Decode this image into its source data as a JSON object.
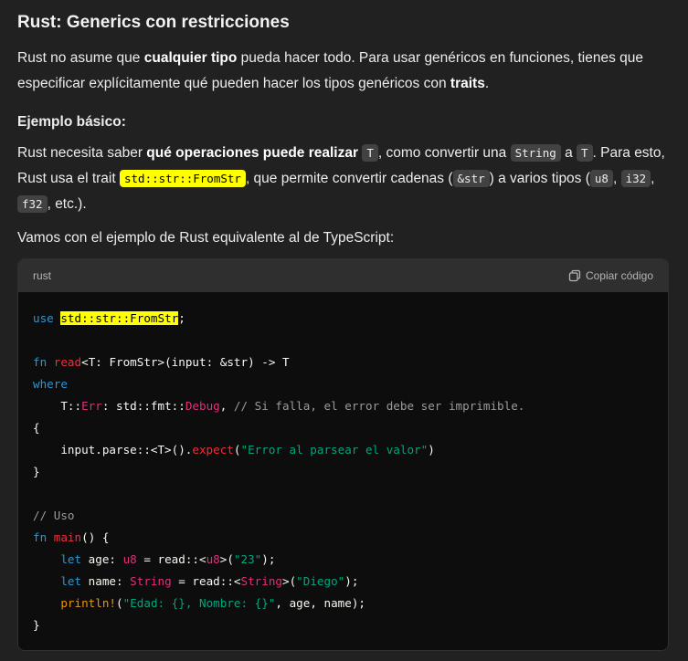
{
  "title": "Rust: Generics con restricciones",
  "intro": {
    "t1": "Rust no asume que ",
    "b1": "cualquier tipo",
    "t2": " pueda hacer todo. Para usar genéricos en funciones, tienes que especificar explícitamente qué pueden hacer los tipos genéricos con ",
    "b2": "traits",
    "t3": "."
  },
  "section_heading": "Ejemplo básico:",
  "para2": {
    "t1": "Rust necesita saber ",
    "b1": "qué operaciones puede realizar",
    "c1": "T",
    "t2": ", como convertir una ",
    "c2": "String",
    "t3": " a ",
    "c3": "T",
    "t4": ". Para esto, Rust usa el trait ",
    "c4": "std::str::FromStr",
    "t5": ", que permite convertir cadenas (",
    "c5": "&str",
    "t6": ") a varios tipos (",
    "c6": "u8",
    "t7": ", ",
    "c7": "i32",
    "t8": ", ",
    "c8": "f32",
    "t9": ", etc.)."
  },
  "para3": "Vamos con el ejemplo de Rust equivalente al de TypeScript:",
  "codeblock": {
    "language": "rust",
    "copy_label": "Copiar código",
    "lines": [
      "use std::str::FromStr;",
      "",
      "fn read<T: FromStr>(input: &str) -> T",
      "where",
      "    T::Err: std::fmt::Debug, // Si falla, el error debe ser imprimible.",
      "{",
      "    input.parse::<T>().expect(\"Error al parsear el valor\")",
      "}",
      "",
      "// Uso",
      "fn main() {",
      "    let age: u8 = read::<u8>(\"23\");",
      "    let name: String = read::<String>(\"Diego\");",
      "    println!(\"Edad: {}, Nombre: {}\", age, name);",
      "}"
    ]
  },
  "colors": {
    "background": "#212121",
    "code_bg": "#0d0d0d",
    "highlight": "#ffff00",
    "keyword": "#2e95d3",
    "string": "#00a67d"
  }
}
